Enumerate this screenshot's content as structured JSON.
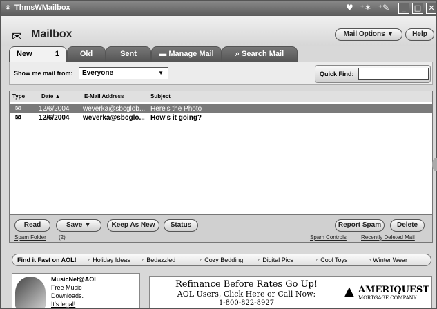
{
  "window": {
    "title": "ThmsWMailbox"
  },
  "header": {
    "title": "Mailbox",
    "mail_options": "Mail Options",
    "help": "Help"
  },
  "tabs": [
    {
      "label": "New",
      "count": "1"
    },
    {
      "label": "Old"
    },
    {
      "label": "Sent"
    },
    {
      "label": "Manage Mail"
    },
    {
      "label": "Search Mail"
    }
  ],
  "filter": {
    "label": "Show me mail from:",
    "value": "Everyone",
    "quick_find_label": "Quick Find:",
    "quick_find_value": ""
  },
  "list": {
    "columns": [
      "Type",
      "Date ▲",
      "E-Mail Address",
      "Subject"
    ],
    "rows": [
      {
        "date": "12/6/2004",
        "address": "weverka@sbcglob...",
        "subject": "Here's the Photo",
        "state": "selected"
      },
      {
        "date": "12/6/2004",
        "address": "weverka@sbcglo...",
        "subject": "How's it going?",
        "state": "unread"
      }
    ]
  },
  "actions": {
    "read": "Read",
    "save": "Save",
    "keep_as_new": "Keep As New",
    "status": "Status",
    "report_spam": "Report Spam",
    "delete": "Delete",
    "spam_folder": "Spam Folder",
    "spam_folder_count": "(2)",
    "spam_controls": "Spam Controls",
    "recently_deleted": "Recently Deleted Mail"
  },
  "find_it_fast": {
    "label": "Find it Fast on AOL!",
    "items": [
      "Holiday Ideas",
      "Bedazzled",
      "Cozy Bedding",
      "Digital Pics",
      "Cool Toys",
      "Winter Wear"
    ]
  },
  "promo": {
    "title": "MusicNet@AOL",
    "line1": "Free Music",
    "line2": "Downloads.",
    "legal": "It's legal!"
  },
  "ad": {
    "line1": "Refinance Before Rates Go Up!",
    "line2": "AOL Users, Click Here or Call Now:",
    "line3": "1-800-822-8927",
    "brand": "AMERIQUEST",
    "brand_sub": "MORTGAGE COMPANY"
  }
}
